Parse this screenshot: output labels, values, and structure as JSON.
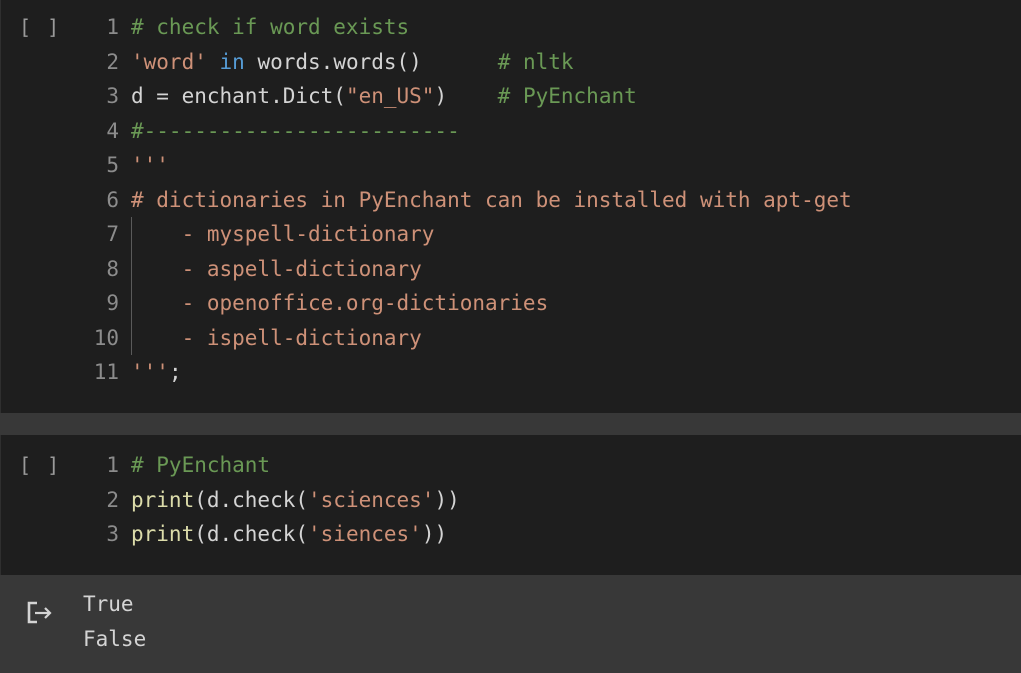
{
  "cell1": {
    "run_label": "[ ]",
    "lines": [
      {
        "n": "1",
        "tokens": [
          {
            "t": "# check if word exists",
            "c": "c-comment"
          }
        ]
      },
      {
        "n": "2",
        "tokens": [
          {
            "t": "'word'",
            "c": "c-string"
          },
          {
            "t": " ",
            "c": "c-plain"
          },
          {
            "t": "in",
            "c": "c-kw"
          },
          {
            "t": " words.words()      ",
            "c": "c-plain"
          },
          {
            "t": "# nltk",
            "c": "c-comment"
          }
        ]
      },
      {
        "n": "3",
        "tokens": [
          {
            "t": "d = enchant.Dict(",
            "c": "c-plain"
          },
          {
            "t": "\"en_US\"",
            "c": "c-string"
          },
          {
            "t": ")    ",
            "c": "c-plain"
          },
          {
            "t": "# PyEnchant",
            "c": "c-comment"
          }
        ]
      },
      {
        "n": "4",
        "tokens": [
          {
            "t": "#-------------------------",
            "c": "c-comment"
          }
        ]
      },
      {
        "n": "5",
        "tokens": [
          {
            "t": "'''",
            "c": "c-string"
          }
        ]
      },
      {
        "n": "6",
        "tokens": [
          {
            "t": "# dictionaries in PyEnchant can be installed with apt-get",
            "c": "c-string"
          }
        ]
      },
      {
        "n": "7",
        "guide": true,
        "tokens": [
          {
            "t": "    - myspell-dictionary",
            "c": "c-string"
          }
        ]
      },
      {
        "n": "8",
        "guide": true,
        "tokens": [
          {
            "t": "    - aspell-dictionary",
            "c": "c-string"
          }
        ]
      },
      {
        "n": "9",
        "guide": true,
        "tokens": [
          {
            "t": "    - openoffice.org-dictionaries",
            "c": "c-string"
          }
        ]
      },
      {
        "n": "10",
        "guide": true,
        "tokens": [
          {
            "t": "    - ispell-dictionary",
            "c": "c-string"
          }
        ]
      },
      {
        "n": "11",
        "tokens": [
          {
            "t": "'''",
            "c": "c-string"
          },
          {
            "t": ";",
            "c": "c-plain"
          }
        ]
      }
    ]
  },
  "cell2": {
    "run_label": "[ ]",
    "lines": [
      {
        "n": "1",
        "tokens": [
          {
            "t": "# PyEnchant",
            "c": "c-comment"
          }
        ]
      },
      {
        "n": "2",
        "tokens": [
          {
            "t": "print",
            "c": "c-fn"
          },
          {
            "t": "(d.check(",
            "c": "c-plain"
          },
          {
            "t": "'sciences'",
            "c": "c-string"
          },
          {
            "t": "))",
            "c": "c-plain"
          }
        ]
      },
      {
        "n": "3",
        "tokens": [
          {
            "t": "print",
            "c": "c-fn"
          },
          {
            "t": "(d.check(",
            "c": "c-plain"
          },
          {
            "t": "'siences'",
            "c": "c-string"
          },
          {
            "t": "))",
            "c": "c-plain"
          }
        ]
      }
    ],
    "output": {
      "icon": "output-redirect-icon",
      "lines": [
        "True",
        "False"
      ]
    }
  }
}
